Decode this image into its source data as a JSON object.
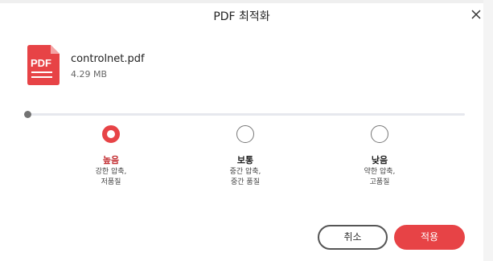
{
  "dialog": {
    "title": "PDF 최적화",
    "close_icon": "close-icon"
  },
  "file": {
    "icon": "pdf-file-icon",
    "icon_label": "PDF",
    "name": "controlnet.pdf",
    "size": "4.29 MB"
  },
  "quality": {
    "options": [
      {
        "label": "높음",
        "desc_line1": "강한 압축,",
        "desc_line2": "저품질",
        "selected": true
      },
      {
        "label": "보통",
        "desc_line1": "중간 압축,",
        "desc_line2": "중간 품질",
        "selected": false
      },
      {
        "label": "낮음",
        "desc_line1": "약한 압축,",
        "desc_line2": "고품질",
        "selected": false
      }
    ],
    "selected_index": 0
  },
  "buttons": {
    "cancel_label": "취소",
    "apply_label": "적용"
  },
  "colors": {
    "accent": "#e74346",
    "selected_text": "#c12a2e",
    "track": "#e6e8ee",
    "knob": "#737373"
  }
}
